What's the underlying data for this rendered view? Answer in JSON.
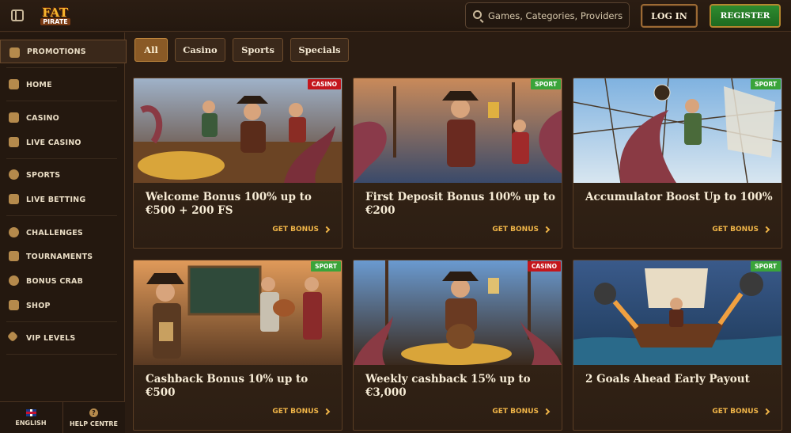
{
  "header": {
    "logo_top": "FAT",
    "logo_bottom": "PIRATE",
    "search_placeholder": "Games, Categories, Providers",
    "login_label": "LOG IN",
    "register_label": "REGISTER"
  },
  "sidebar": {
    "items": [
      {
        "label": "PROMOTIONS",
        "icon": "gift-icon",
        "active": true
      },
      {
        "label": "HOME",
        "icon": "home-icon"
      },
      {
        "label": "CASINO",
        "icon": "slot-machine-icon"
      },
      {
        "label": "LIVE CASINO",
        "icon": "live-card-icon"
      },
      {
        "label": "SPORTS",
        "icon": "soccer-ball-icon"
      },
      {
        "label": "LIVE BETTING",
        "icon": "live-betting-icon"
      },
      {
        "label": "CHALLENGES",
        "icon": "medal-icon"
      },
      {
        "label": "TOURNAMENTS",
        "icon": "trophy-icon"
      },
      {
        "label": "BONUS CRAB",
        "icon": "crab-icon"
      },
      {
        "label": "SHOP",
        "icon": "shop-bag-icon"
      },
      {
        "label": "VIP LEVELS",
        "icon": "diamond-icon"
      }
    ],
    "footer": {
      "language_label": "ENGLISH",
      "help_label": "HELP CENTRE"
    }
  },
  "filters": [
    {
      "label": "All",
      "active": true
    },
    {
      "label": "Casino"
    },
    {
      "label": "Sports"
    },
    {
      "label": "Specials"
    }
  ],
  "promotions": [
    {
      "title": "Welcome Bonus 100% up to €500 + 200 FS",
      "badge": "CASINO",
      "badge_type": "casino",
      "cta": "GET BONUS"
    },
    {
      "title": "First Deposit Bonus 100% up to €200",
      "badge": "SPORT",
      "badge_type": "sport",
      "cta": "GET BONUS"
    },
    {
      "title": "Accumulator Boost Up to 100%",
      "badge": "SPORT",
      "badge_type": "sport",
      "cta": "GET BONUS"
    },
    {
      "title": "Cashback Bonus 10% up to €500",
      "badge": "SPORT",
      "badge_type": "sport",
      "cta": "GET BONUS"
    },
    {
      "title": "Weekly cashback 15% up to €3,000",
      "badge": "CASINO",
      "badge_type": "casino",
      "cta": "GET BONUS"
    },
    {
      "title": "2 Goals Ahead Early Payout",
      "badge": "SPORT",
      "badge_type": "sport",
      "cta": "GET BONUS"
    }
  ],
  "colors": {
    "accent": "#f0b548",
    "casino_badge": "#c4161c",
    "sport_badge": "#3aa43a",
    "register_green": "#2e8b2f"
  }
}
